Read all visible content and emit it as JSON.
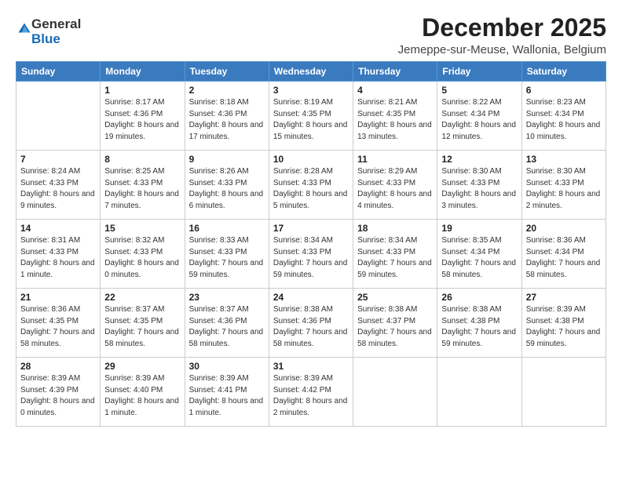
{
  "logo": {
    "general": "General",
    "blue": "Blue"
  },
  "header": {
    "month": "December 2025",
    "location": "Jemeppe-sur-Meuse, Wallonia, Belgium"
  },
  "weekdays": [
    "Sunday",
    "Monday",
    "Tuesday",
    "Wednesday",
    "Thursday",
    "Friday",
    "Saturday"
  ],
  "weeks": [
    [
      {
        "day": "",
        "sunrise": "",
        "sunset": "",
        "daylight": ""
      },
      {
        "day": "1",
        "sunrise": "Sunrise: 8:17 AM",
        "sunset": "Sunset: 4:36 PM",
        "daylight": "Daylight: 8 hours and 19 minutes."
      },
      {
        "day": "2",
        "sunrise": "Sunrise: 8:18 AM",
        "sunset": "Sunset: 4:36 PM",
        "daylight": "Daylight: 8 hours and 17 minutes."
      },
      {
        "day": "3",
        "sunrise": "Sunrise: 8:19 AM",
        "sunset": "Sunset: 4:35 PM",
        "daylight": "Daylight: 8 hours and 15 minutes."
      },
      {
        "day": "4",
        "sunrise": "Sunrise: 8:21 AM",
        "sunset": "Sunset: 4:35 PM",
        "daylight": "Daylight: 8 hours and 13 minutes."
      },
      {
        "day": "5",
        "sunrise": "Sunrise: 8:22 AM",
        "sunset": "Sunset: 4:34 PM",
        "daylight": "Daylight: 8 hours and 12 minutes."
      },
      {
        "day": "6",
        "sunrise": "Sunrise: 8:23 AM",
        "sunset": "Sunset: 4:34 PM",
        "daylight": "Daylight: 8 hours and 10 minutes."
      }
    ],
    [
      {
        "day": "7",
        "sunrise": "Sunrise: 8:24 AM",
        "sunset": "Sunset: 4:33 PM",
        "daylight": "Daylight: 8 hours and 9 minutes."
      },
      {
        "day": "8",
        "sunrise": "Sunrise: 8:25 AM",
        "sunset": "Sunset: 4:33 PM",
        "daylight": "Daylight: 8 hours and 7 minutes."
      },
      {
        "day": "9",
        "sunrise": "Sunrise: 8:26 AM",
        "sunset": "Sunset: 4:33 PM",
        "daylight": "Daylight: 8 hours and 6 minutes."
      },
      {
        "day": "10",
        "sunrise": "Sunrise: 8:28 AM",
        "sunset": "Sunset: 4:33 PM",
        "daylight": "Daylight: 8 hours and 5 minutes."
      },
      {
        "day": "11",
        "sunrise": "Sunrise: 8:29 AM",
        "sunset": "Sunset: 4:33 PM",
        "daylight": "Daylight: 8 hours and 4 minutes."
      },
      {
        "day": "12",
        "sunrise": "Sunrise: 8:30 AM",
        "sunset": "Sunset: 4:33 PM",
        "daylight": "Daylight: 8 hours and 3 minutes."
      },
      {
        "day": "13",
        "sunrise": "Sunrise: 8:30 AM",
        "sunset": "Sunset: 4:33 PM",
        "daylight": "Daylight: 8 hours and 2 minutes."
      }
    ],
    [
      {
        "day": "14",
        "sunrise": "Sunrise: 8:31 AM",
        "sunset": "Sunset: 4:33 PM",
        "daylight": "Daylight: 8 hours and 1 minute."
      },
      {
        "day": "15",
        "sunrise": "Sunrise: 8:32 AM",
        "sunset": "Sunset: 4:33 PM",
        "daylight": "Daylight: 8 hours and 0 minutes."
      },
      {
        "day": "16",
        "sunrise": "Sunrise: 8:33 AM",
        "sunset": "Sunset: 4:33 PM",
        "daylight": "Daylight: 7 hours and 59 minutes."
      },
      {
        "day": "17",
        "sunrise": "Sunrise: 8:34 AM",
        "sunset": "Sunset: 4:33 PM",
        "daylight": "Daylight: 7 hours and 59 minutes."
      },
      {
        "day": "18",
        "sunrise": "Sunrise: 8:34 AM",
        "sunset": "Sunset: 4:33 PM",
        "daylight": "Daylight: 7 hours and 59 minutes."
      },
      {
        "day": "19",
        "sunrise": "Sunrise: 8:35 AM",
        "sunset": "Sunset: 4:34 PM",
        "daylight": "Daylight: 7 hours and 58 minutes."
      },
      {
        "day": "20",
        "sunrise": "Sunrise: 8:36 AM",
        "sunset": "Sunset: 4:34 PM",
        "daylight": "Daylight: 7 hours and 58 minutes."
      }
    ],
    [
      {
        "day": "21",
        "sunrise": "Sunrise: 8:36 AM",
        "sunset": "Sunset: 4:35 PM",
        "daylight": "Daylight: 7 hours and 58 minutes."
      },
      {
        "day": "22",
        "sunrise": "Sunrise: 8:37 AM",
        "sunset": "Sunset: 4:35 PM",
        "daylight": "Daylight: 7 hours and 58 minutes."
      },
      {
        "day": "23",
        "sunrise": "Sunrise: 8:37 AM",
        "sunset": "Sunset: 4:36 PM",
        "daylight": "Daylight: 7 hours and 58 minutes."
      },
      {
        "day": "24",
        "sunrise": "Sunrise: 8:38 AM",
        "sunset": "Sunset: 4:36 PM",
        "daylight": "Daylight: 7 hours and 58 minutes."
      },
      {
        "day": "25",
        "sunrise": "Sunrise: 8:38 AM",
        "sunset": "Sunset: 4:37 PM",
        "daylight": "Daylight: 7 hours and 58 minutes."
      },
      {
        "day": "26",
        "sunrise": "Sunrise: 8:38 AM",
        "sunset": "Sunset: 4:38 PM",
        "daylight": "Daylight: 7 hours and 59 minutes."
      },
      {
        "day": "27",
        "sunrise": "Sunrise: 8:39 AM",
        "sunset": "Sunset: 4:38 PM",
        "daylight": "Daylight: 7 hours and 59 minutes."
      }
    ],
    [
      {
        "day": "28",
        "sunrise": "Sunrise: 8:39 AM",
        "sunset": "Sunset: 4:39 PM",
        "daylight": "Daylight: 8 hours and 0 minutes."
      },
      {
        "day": "29",
        "sunrise": "Sunrise: 8:39 AM",
        "sunset": "Sunset: 4:40 PM",
        "daylight": "Daylight: 8 hours and 1 minute."
      },
      {
        "day": "30",
        "sunrise": "Sunrise: 8:39 AM",
        "sunset": "Sunset: 4:41 PM",
        "daylight": "Daylight: 8 hours and 1 minute."
      },
      {
        "day": "31",
        "sunrise": "Sunrise: 8:39 AM",
        "sunset": "Sunset: 4:42 PM",
        "daylight": "Daylight: 8 hours and 2 minutes."
      },
      {
        "day": "",
        "sunrise": "",
        "sunset": "",
        "daylight": ""
      },
      {
        "day": "",
        "sunrise": "",
        "sunset": "",
        "daylight": ""
      },
      {
        "day": "",
        "sunrise": "",
        "sunset": "",
        "daylight": ""
      }
    ]
  ]
}
